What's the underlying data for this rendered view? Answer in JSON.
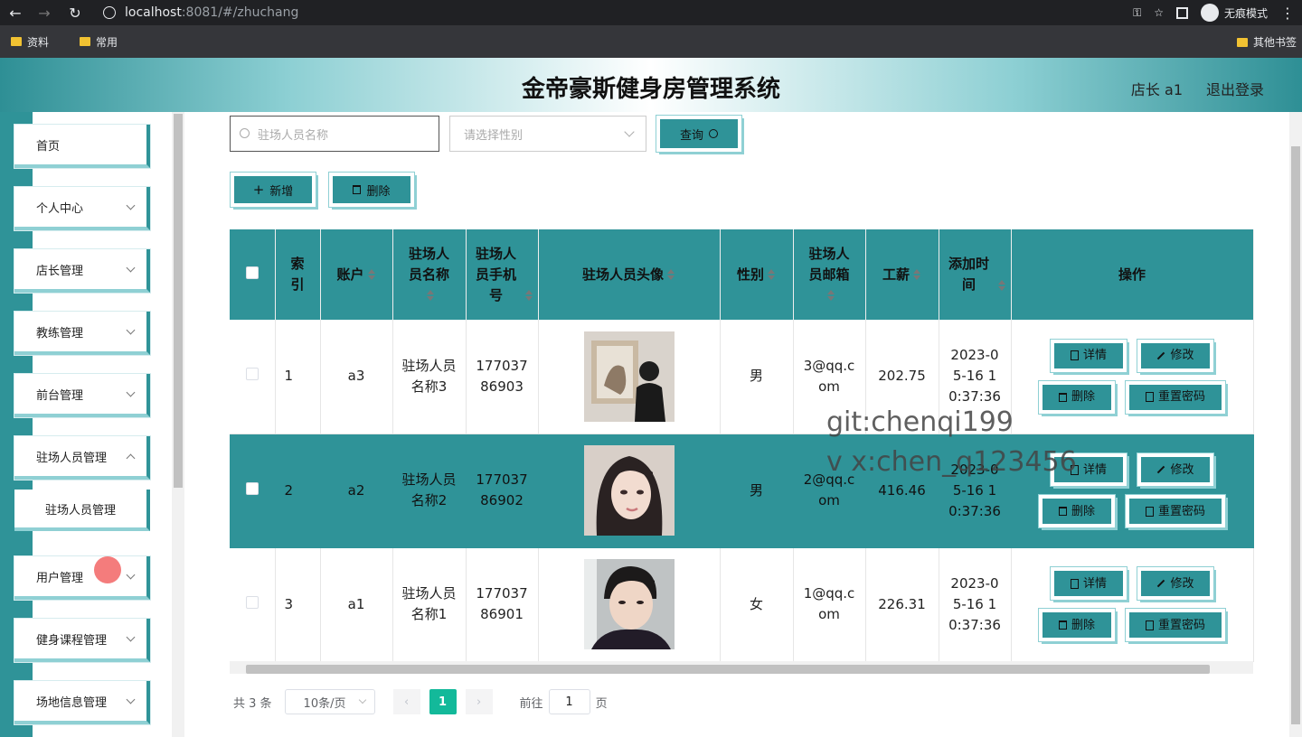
{
  "browser": {
    "url_host": "localhost",
    "url_rest": ":8081/#/zhuchang",
    "incognito_label": "无痕模式",
    "bookmarks": [
      "资料",
      "常用"
    ],
    "bookmarks_right": "其他书签"
  },
  "header": {
    "title": "金帝豪斯健身房管理系统",
    "user": "店长 a1",
    "logout": "退出登录"
  },
  "sidebar": {
    "items": [
      {
        "label": "首页"
      },
      {
        "label": "个人中心"
      },
      {
        "label": "店长管理"
      },
      {
        "label": "教练管理"
      },
      {
        "label": "前台管理"
      },
      {
        "label": "驻场人员管理"
      },
      {
        "label": "用户管理"
      },
      {
        "label": "健身课程管理"
      },
      {
        "label": "场地信息管理"
      }
    ],
    "sub_item": "驻场人员管理"
  },
  "toolbar": {
    "search_placeholder": "驻场人员名称",
    "gender_placeholder": "请选择性别",
    "query_label": "查询",
    "add_label": "新增",
    "delete_label": "删除"
  },
  "table": {
    "headers": {
      "index": "索引",
      "account": "账户",
      "name": "驻场人员名称",
      "phone": "驻场人员手机号",
      "avatar": "驻场人员头像",
      "gender": "性别",
      "email": "驻场人员邮箱",
      "salary": "工薪",
      "added": "添加时间",
      "ops": "操作"
    },
    "rows": [
      {
        "index": "1",
        "account": "a3",
        "name": "驻场人员名称3",
        "phone": "17703786903",
        "gender": "男",
        "email": "3@qq.com",
        "salary": "202.75",
        "added": "2023-05-16 10:37:36"
      },
      {
        "index": "2",
        "account": "a2",
        "name": "驻场人员名称2",
        "phone": "17703786902",
        "gender": "男",
        "email": "2@qq.com",
        "salary": "416.46",
        "added": "2023-05-16 10:37:36"
      },
      {
        "index": "3",
        "account": "a1",
        "name": "驻场人员名称1",
        "phone": "17703786901",
        "gender": "女",
        "email": "1@qq.com",
        "salary": "226.31",
        "added": "2023-05-16 10:37:36"
      }
    ],
    "ops": {
      "detail": "详情",
      "edit": "修改",
      "delete": "删除",
      "reset": "重置密码"
    }
  },
  "pager": {
    "total": "共 3 条",
    "page_size": "10条/页",
    "current": "1",
    "goto_label": "前往",
    "goto_value": "1",
    "page_unit": "页"
  },
  "watermark": {
    "line1": "git:chenqi199",
    "line2": "v x:chen_q123456"
  },
  "colors": {
    "accent": "#2f9398",
    "accent_light": "#8fd0d4",
    "pager_active": "#13b99a"
  }
}
